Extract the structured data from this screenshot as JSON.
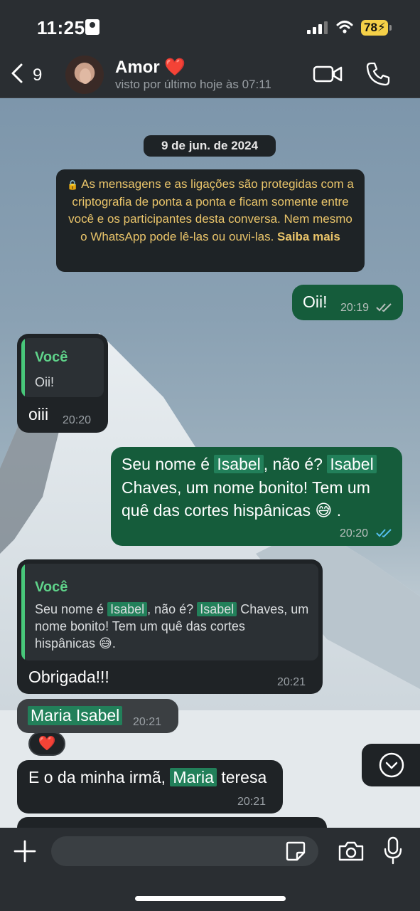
{
  "status_bar": {
    "time": "11:25",
    "battery": "78"
  },
  "header": {
    "back_count": "9",
    "contact_name": "Amor ❤️",
    "contact_status": "visto por último hoje às 07:11"
  },
  "chat": {
    "date": "9 de jun. de 2024",
    "encryption_notice": {
      "lock": "🔒",
      "text": "As mensagens e as ligações são protegidas com a criptografia de ponta a ponta e ficam somente entre você e os participantes desta conversa. Nem mesmo o WhatsApp pode lê-las ou ouvi-las.",
      "link": "Saiba mais"
    },
    "messages": [
      {
        "id": "m1",
        "text": "Oii!",
        "time": "20:19"
      },
      {
        "id": "m2",
        "quote_author": "Você",
        "quote_text": "Oii!",
        "text": "oiii",
        "time": "20:20"
      },
      {
        "id": "m3",
        "line1": [
          "Seu nome é ",
          "Isabel",
          ", não é? ",
          "Isabel"
        ],
        "line2": "Chaves, um nome bonito! Tem um",
        "line3": "quê das cortes hispânicas 😅 .",
        "time": "20:20"
      },
      {
        "id": "m4",
        "quote_author": "Você",
        "quote_line1": [
          "Seu nome é ",
          "Isabel",
          ", não é? ",
          "Isabel",
          " Chaves, um"
        ],
        "quote_line2": "nome bonito! Tem um quê das cortes",
        "quote_line3": "hispânicas 😅.",
        "text": "Obrigada!!!",
        "time": "20:21"
      },
      {
        "id": "m5",
        "text": "Maria Isabel",
        "time": "20:21",
        "reaction": "❤️"
      },
      {
        "id": "m6",
        "parts": [
          "E o da minha irmã, ",
          "Maria",
          " teresa"
        ],
        "time": "20:21"
      }
    ]
  },
  "icons": {
    "back": "chevron-left-icon",
    "video": "video-camera-icon",
    "call": "phone-icon",
    "scroll": "chevron-down-icon",
    "plus": "plus-icon",
    "sticker": "sticker-icon",
    "camera": "camera-icon",
    "mic": "microphone-icon"
  },
  "colors": {
    "outgoing": "#155c3b",
    "incoming": "#1f2326",
    "quote_accent": "#48c77a",
    "read_ticks": "#53bdeb",
    "notice_text": "#e9c46a"
  }
}
